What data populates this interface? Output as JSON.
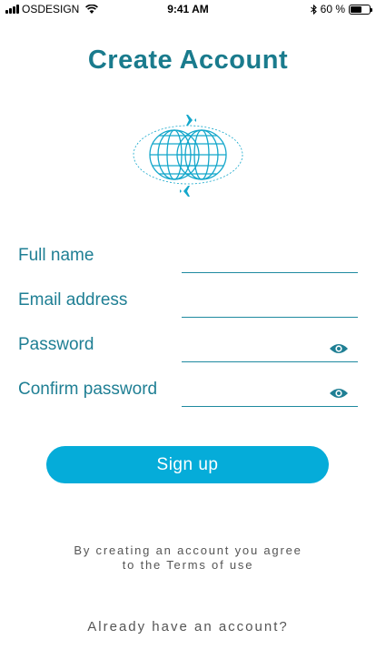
{
  "status_bar": {
    "carrier": "OSDESIGN",
    "time": "9:41 AM",
    "battery_percent": "60 %",
    "battery_level": 0.6,
    "icons": [
      "signal-icon",
      "wifi-icon",
      "bluetooth-icon",
      "battery-icon"
    ]
  },
  "header": {
    "title": "Create Account"
  },
  "logo": {
    "icon": "globe-airplanes-icon"
  },
  "form": {
    "fields": [
      {
        "label": "Full name",
        "value": "",
        "type": "text"
      },
      {
        "label": "Email address",
        "value": "",
        "type": "email"
      },
      {
        "label": "Password",
        "value": "",
        "type": "password",
        "icon": "eye-icon"
      },
      {
        "label": "Confirm password",
        "value": "",
        "type": "password",
        "icon": "eye-icon"
      }
    ]
  },
  "actions": {
    "signup_label": "Sign up"
  },
  "footer": {
    "terms_line1": "By creating an account you agree",
    "terms_line2": "to the Terms of use",
    "login_link": "Already have an account?"
  },
  "colors": {
    "primary_text": "#1f7f94",
    "button_bg": "#05acd9",
    "secondary_text": "#555555"
  }
}
